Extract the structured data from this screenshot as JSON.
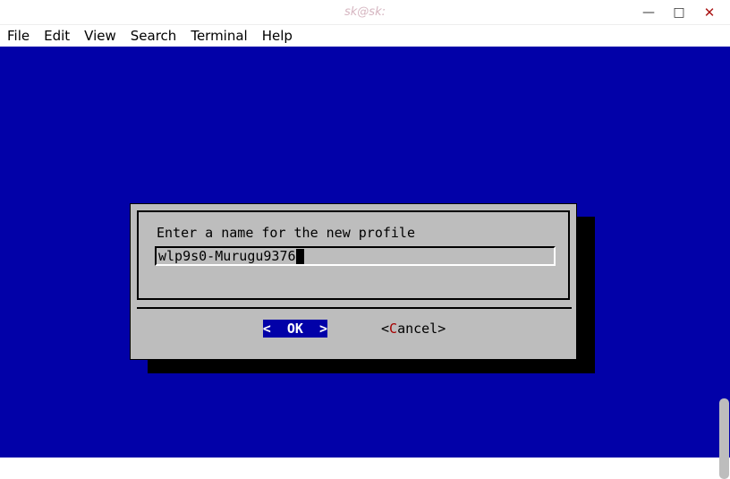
{
  "window": {
    "title": "sk@sk:"
  },
  "window_controls": {
    "minimize": "—",
    "maximize": "□",
    "close": "✕"
  },
  "menubar": [
    "File",
    "Edit",
    "View",
    "Search",
    "Terminal",
    "Help"
  ],
  "dialog": {
    "prompt": "Enter a name for the new profile",
    "input_value": "wlp9s0-Murugu9376",
    "buttons": {
      "ok": "<  OK  >",
      "cancel_left": "<",
      "cancel_hot": "C",
      "cancel_rest": "ancel>"
    }
  }
}
